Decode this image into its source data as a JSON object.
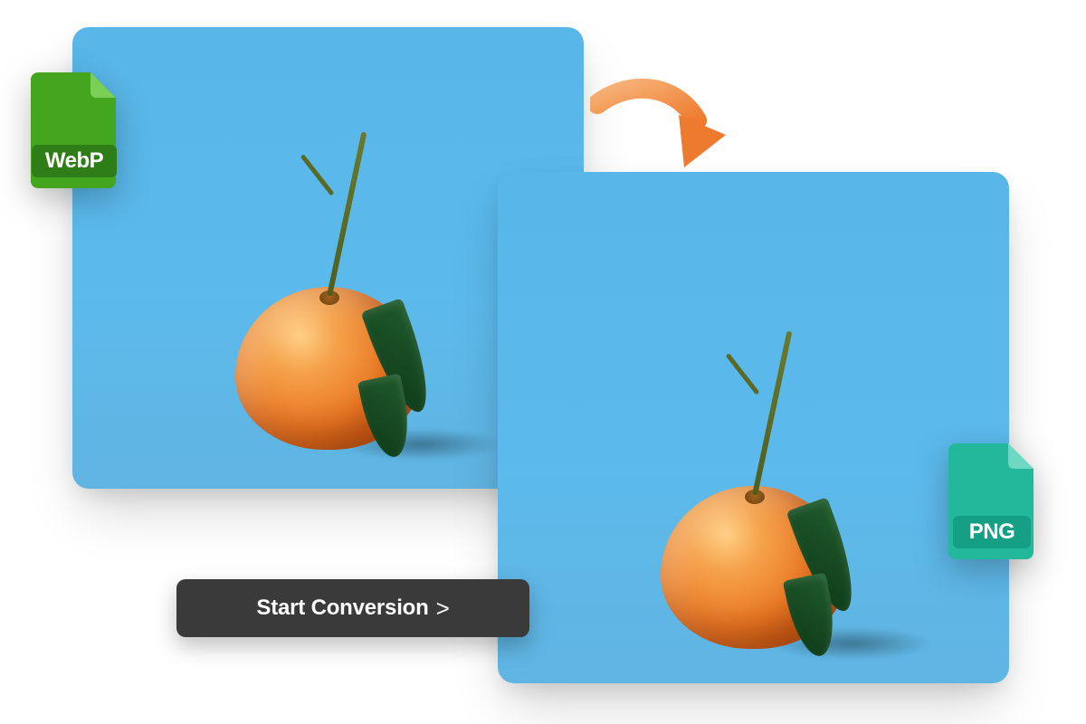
{
  "formats": {
    "source_label": "WebP",
    "target_label": "PNG"
  },
  "cta": {
    "label": "Start Conversion",
    "chevron": ">"
  },
  "icons": {
    "arrow": "conversion-arrow",
    "file_source": "webp-file-icon",
    "file_target": "png-file-icon"
  },
  "colors": {
    "source_badge": "#44a51f",
    "source_badge_dark": "#2f7d16",
    "target_badge": "#23b89b",
    "target_badge_dark": "#15a085",
    "arrow": "#f18a3c",
    "button_bg": "#3a3a3a",
    "photo_bg": "#5bb9eb"
  }
}
